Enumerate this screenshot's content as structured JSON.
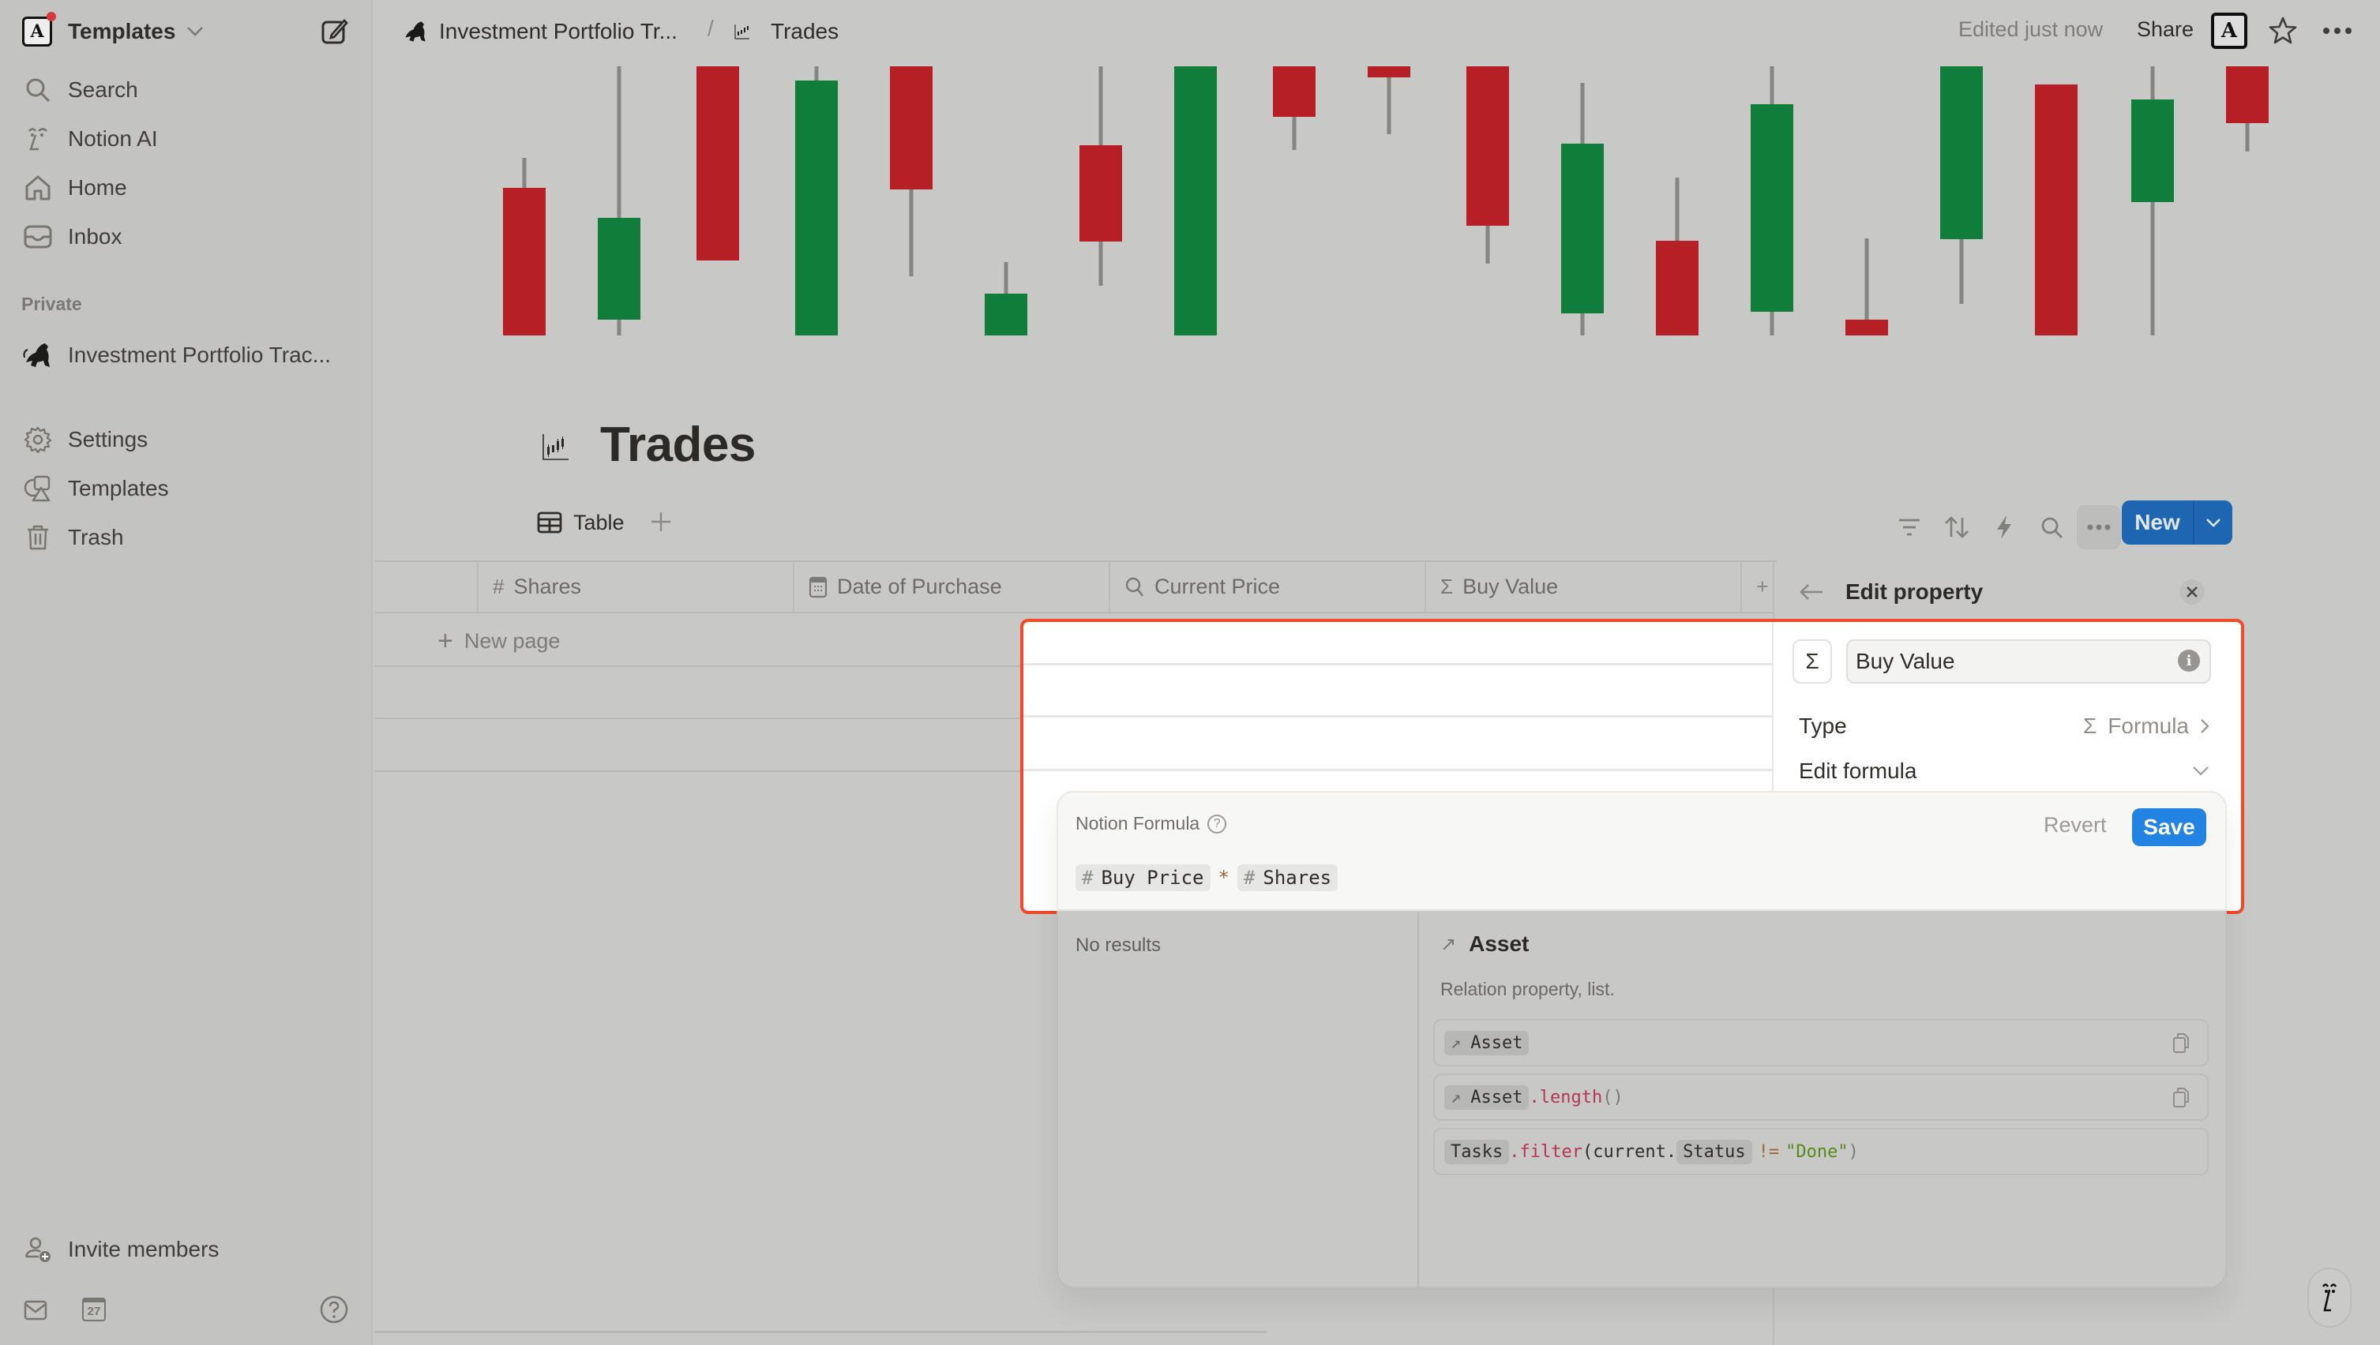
{
  "sidebar": {
    "workspace_name": "Templates",
    "workspace_logo_letter": "A",
    "nav": [
      {
        "label": "Search",
        "icon": "search-icon"
      },
      {
        "label": "Notion AI",
        "icon": "notion-ai-icon"
      },
      {
        "label": "Home",
        "icon": "home-icon"
      },
      {
        "label": "Inbox",
        "icon": "inbox-icon"
      }
    ],
    "section_label": "Private",
    "pages": [
      {
        "label": "Investment Portfolio Trac...",
        "icon": "bull-icon"
      }
    ],
    "utility": [
      {
        "label": "Settings",
        "icon": "gear-icon"
      },
      {
        "label": "Templates",
        "icon": "templates-icon"
      },
      {
        "label": "Trash",
        "icon": "trash-icon"
      }
    ],
    "invite_label": "Invite members",
    "calendar_day": "27"
  },
  "topbar": {
    "breadcrumb": [
      {
        "label": "Investment Portfolio Tr...",
        "icon": "bull-icon"
      },
      {
        "label": "Trades",
        "icon": "candlestick-icon"
      }
    ],
    "separator": "/",
    "edited_status": "Edited just now",
    "share_label": "Share",
    "avatar_letter": "A"
  },
  "page": {
    "title": "Trades",
    "view_tab": "Table",
    "new_button_label": "New",
    "colors": {
      "accent": "#2383e2",
      "candle_up": "#117d3b",
      "candle_down": "#b51f25",
      "highlight_outline": "#f04a28"
    }
  },
  "table": {
    "columns": [
      {
        "label": "Shares",
        "icon": "#"
      },
      {
        "label": "Date of Purchase",
        "icon": "calendar-icon"
      },
      {
        "label": "Current Price",
        "icon": "search-icon"
      },
      {
        "label": "Buy Value",
        "icon": "Σ"
      }
    ],
    "new_page_label": "New page"
  },
  "edit_property": {
    "title": "Edit property",
    "property_icon": "Σ",
    "property_name": "Buy Value",
    "type_label": "Type",
    "type_value": "Formula",
    "type_icon": "Σ",
    "edit_formula_label": "Edit formula"
  },
  "formula_editor": {
    "label": "Notion Formula",
    "revert_label": "Revert",
    "save_label": "Save",
    "expression": {
      "left": "Buy Price",
      "operator": "*",
      "right": "Shares"
    },
    "suggestions_empty": "No results",
    "doc": {
      "title": "Asset",
      "description": "Relation property, list.",
      "examples": [
        {
          "chip": "Asset",
          "suffix_fn": "",
          "suffix_paren": ""
        },
        {
          "chip": "Asset",
          "suffix_fn": ".length",
          "suffix_paren": "()"
        },
        {
          "chip1": "Tasks",
          "fn": ".filter",
          "open": "(current.",
          "chip2": "Status",
          "neq": "!=",
          "str": "\"Done\"",
          "close": ")"
        }
      ]
    }
  }
}
